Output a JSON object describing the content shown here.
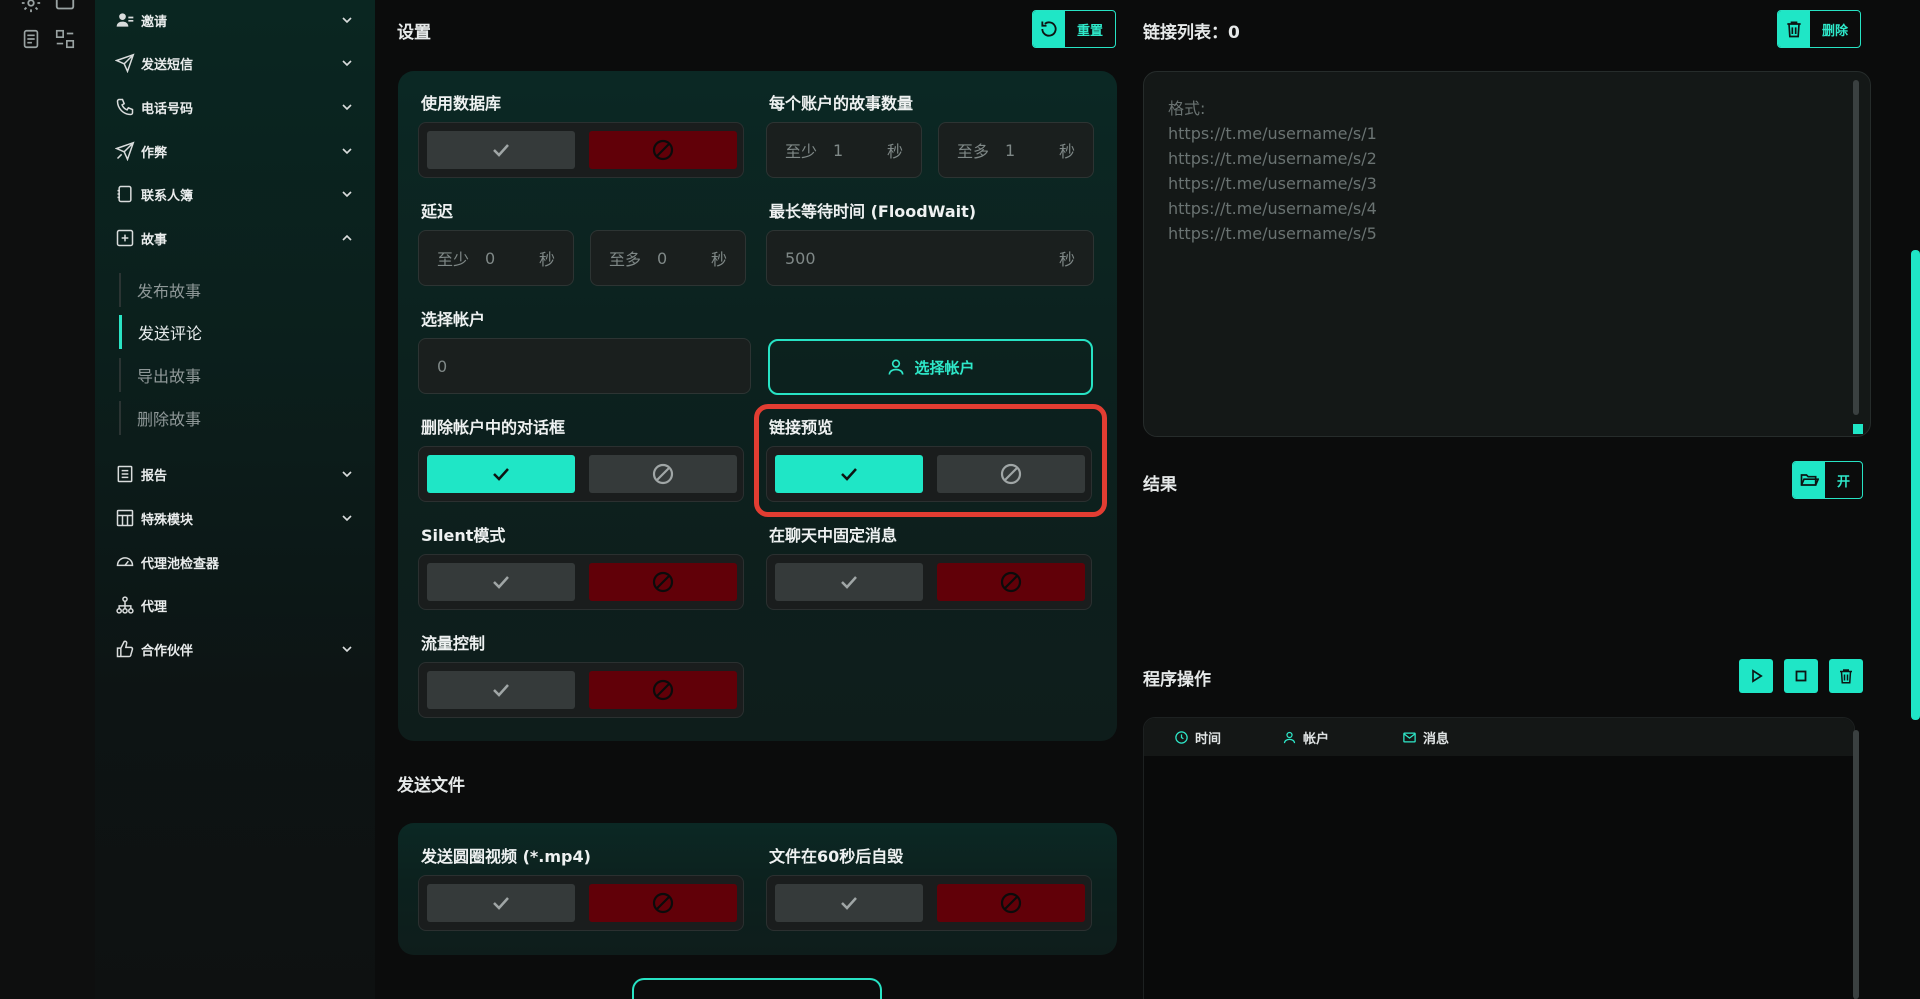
{
  "sidebar": {
    "items": [
      {
        "label": "邀请",
        "icon": "users-icon",
        "expanded": false
      },
      {
        "label": "发送短信",
        "icon": "paper-plane-icon",
        "expanded": false
      },
      {
        "label": "电话号码",
        "icon": "phone-icon",
        "expanded": false
      },
      {
        "label": "作弊",
        "icon": "plane-cheat-icon",
        "expanded": false
      },
      {
        "label": "联系人簿",
        "icon": "contacts-book-icon",
        "expanded": false
      },
      {
        "label": "故事",
        "icon": "plus-square-icon",
        "expanded": true
      },
      {
        "label": "报告",
        "icon": "report-icon",
        "expanded": false
      },
      {
        "label": "特殊模块",
        "icon": "module-grid-icon",
        "expanded": false
      },
      {
        "label": "代理池检查器",
        "icon": "gauge-icon",
        "expanded": null
      },
      {
        "label": "代理",
        "icon": "network-icon",
        "expanded": null
      },
      {
        "label": "合作伙伴",
        "icon": "thumb-up-icon",
        "expanded": false
      }
    ],
    "story_sub": [
      "发布故事",
      "发送评论",
      "导出故事",
      "删除故事"
    ],
    "active_sub": "发送评论"
  },
  "settings": {
    "title": "设置",
    "reset_label": "重置",
    "use_db": {
      "label": "使用数据库",
      "state": "no"
    },
    "stories_per_account": {
      "label": "每个账户的故事数量",
      "min_prefix": "至少",
      "min_value": "1",
      "max_prefix": "至多",
      "max_value": "1",
      "unit": "秒"
    },
    "delay": {
      "label": "延迟",
      "min_prefix": "至少",
      "min_value": "0",
      "max_prefix": "至多",
      "max_value": "0",
      "unit": "秒"
    },
    "floodwait": {
      "label": "最长等待时间 (FloodWait)",
      "value": "500",
      "unit": "秒"
    },
    "select_account": {
      "label": "选择帐户",
      "value": "0",
      "button_label": "选择帐户"
    },
    "delete_dialog": {
      "label": "删除帐户中的对话框",
      "state": "yes"
    },
    "link_preview": {
      "label": "链接预览",
      "state": "yes"
    },
    "silent": {
      "label": "Silent模式",
      "state": "no"
    },
    "pin_message": {
      "label": "在聊天中固定消息",
      "state": "no"
    },
    "traffic": {
      "label": "流量控制",
      "state": "no"
    }
  },
  "send_file": {
    "title": "发送文件",
    "circle_video": {
      "label": "发送圆圈视频 (*.mp4)",
      "state": "no"
    },
    "self_destruct": {
      "label": "文件在60秒后自毁",
      "state": "no"
    }
  },
  "links": {
    "title": "链接列表：0",
    "delete_label": "删除",
    "placeholder": "格式:\nhttps://t.me/username/s/1\nhttps://t.me/username/s/2\nhttps://t.me/username/s/3\nhttps://t.me/username/s/4\nhttps://t.me/username/s/5"
  },
  "results": {
    "title": "结果",
    "open_label": "开"
  },
  "program": {
    "title": "程序操作",
    "columns": [
      {
        "label": "时间",
        "icon": "clock-icon"
      },
      {
        "label": "帐户",
        "icon": "user-icon"
      },
      {
        "label": "消息",
        "icon": "mail-icon"
      }
    ]
  },
  "colors": {
    "accent": "#1fe6c6",
    "danger": "#610008",
    "highlight": "#e23d32"
  }
}
